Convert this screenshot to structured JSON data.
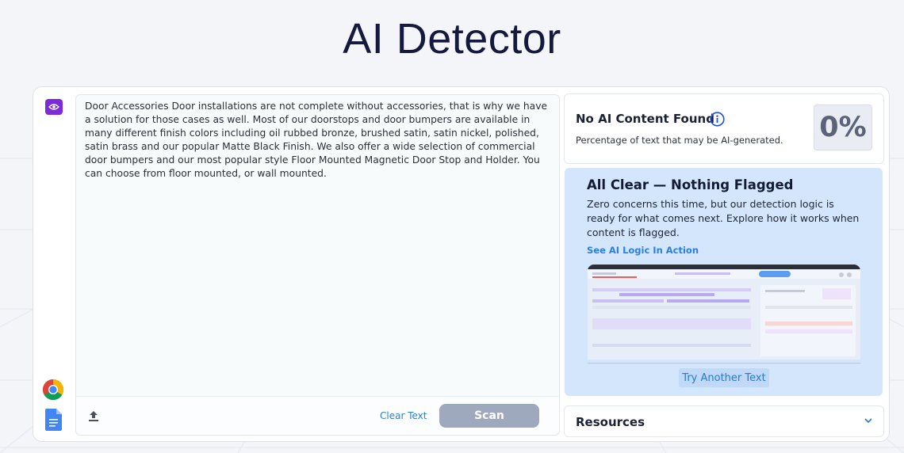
{
  "page": {
    "title": "AI Detector"
  },
  "editor": {
    "text": "Door Accessories Door installations are not complete without accessories, that is why we have a solution for those cases as well. Most of our doorstops and door bumpers are available in many different finish colors including oil rubbed bronze, brushed satin, satin nickel, polished, satin brass and our popular Matte Black Finish. We also offer a wide selection of commercial door bumpers and our most popular style Floor Mounted Magnetic Door Stop and Holder. You can choose from floor mounted, or wall mounted.",
    "clear_label": "Clear Text",
    "scan_label": "Scan"
  },
  "result": {
    "title": "No AI Content Found",
    "subtitle": "Percentage of text that may be AI-generated.",
    "percent": "0%"
  },
  "panel": {
    "heading": "All Clear — Nothing Flagged",
    "body": "Zero concerns this time, but our detection logic is ready for what comes next. Explore how it works when content is flagged.",
    "link_label": "See AI Logic In Action",
    "try_label": "Try Another Text"
  },
  "resources": {
    "label": "Resources"
  },
  "icons": {
    "rail_top": "eye-icon",
    "rail_bottom": [
      "chrome-icon",
      "google-docs-icon"
    ],
    "upload": "upload-icon",
    "info": "info-icon",
    "chevron": "chevron-down-icon"
  },
  "colors": {
    "accent_purple": "#7c2bd8",
    "link_blue": "#2d7fd6",
    "scan_disabled": "#9ea9bd",
    "panel_bg": "#d4e6fc",
    "title": "#15193d"
  }
}
